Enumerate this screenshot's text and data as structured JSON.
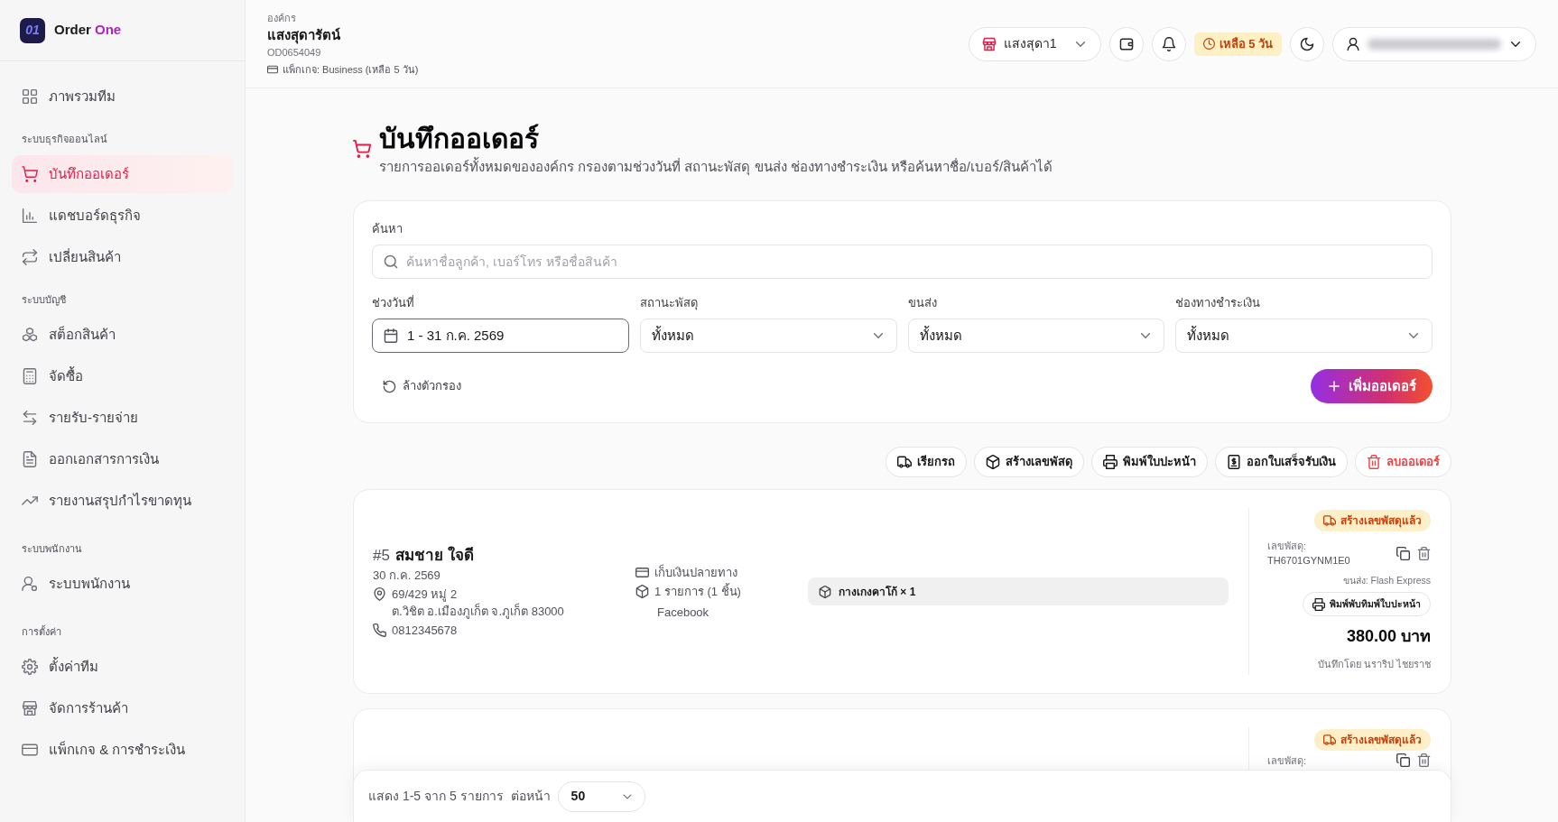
{
  "brand": {
    "logo": "01",
    "name": "Order",
    "name_accent": "One"
  },
  "sidebar": {
    "sections": [
      {
        "items": [
          {
            "label": "ภาพรวมทีม",
            "selected": false
          }
        ]
      },
      {
        "title": "ระบบธุรกิจออนไลน์",
        "items": [
          {
            "label": "บันทึกออเดอร์",
            "selected": true
          },
          {
            "label": "แดชบอร์ดธุรกิจ",
            "selected": false
          },
          {
            "label": "เปลี่ยนสินค้า",
            "selected": false
          }
        ]
      },
      {
        "title": "ระบบบัญชี",
        "items": [
          {
            "label": "สต็อกสินค้า",
            "selected": false
          },
          {
            "label": "จัดซื้อ",
            "selected": false
          },
          {
            "label": "รายรับ-รายจ่าย",
            "selected": false
          },
          {
            "label": "ออกเอกสารการเงิน",
            "selected": false
          },
          {
            "label": "รายงานสรุปกำไรขาดทุน",
            "selected": false
          }
        ]
      },
      {
        "title": "ระบบพนักงาน",
        "items": [
          {
            "label": "ระบบพนักงาน",
            "selected": false
          }
        ]
      },
      {
        "title": "การตั้งค่า",
        "items": [
          {
            "label": "ตั้งค่าทีม",
            "selected": false
          },
          {
            "label": "จัดการร้านค้า",
            "selected": false
          },
          {
            "label": "แพ็กเกจ & การชำระเงิน",
            "selected": false
          }
        ]
      }
    ]
  },
  "header": {
    "org_label": "องค์กร",
    "org_name": "แสงสุดารัตน์",
    "org_code": "OD0654049",
    "package": "แพ็กเกจ: Business (เหลือ 5 วัน)",
    "store": "แสงสุดา1",
    "trial": "เหลือ 5 วัน"
  },
  "page": {
    "title": "บันทึกออเดอร์",
    "subtitle": "รายการออเดอร์ทั้งหมดขององค์กร กรองตามช่วงวันที่ สถานะพัสดุ ขนส่ง ช่องทางชำระเงิน หรือค้นหาชื่อ/เบอร์/สินค้าได้"
  },
  "filters": {
    "search": {
      "label": "ค้นหา",
      "placeholder": "ค้นหาชื่อลูกค้า, เบอร์โทร หรือชื่อสินค้า"
    },
    "fields": [
      {
        "kind": "date",
        "label": "ช่วงวันที่",
        "value": "1 - 31 ก.ค. 2569",
        "focused": true
      },
      {
        "kind": "select",
        "label": "สถานะพัสดุ",
        "value": "ทั้งหมด",
        "focused": false
      },
      {
        "kind": "select",
        "label": "ขนส่ง",
        "value": "ทั้งหมด",
        "focused": false
      },
      {
        "kind": "select",
        "label": "ช่องทางชำระเงิน",
        "value": "ทั้งหมด",
        "focused": false
      }
    ],
    "clear_button": "ล้างตัวกรอง",
    "add_button": "เพิ่มออเดอร์"
  },
  "toolbar": [
    {
      "label": "เรียกรถ",
      "kind": "default"
    },
    {
      "label": "สร้างเลขพัสดุ",
      "kind": "default"
    },
    {
      "label": "พิมพ์ใบปะหน้า",
      "kind": "default"
    },
    {
      "label": "ออกใบเสร็จรับเงิน",
      "kind": "default"
    },
    {
      "label": "ลบออเดอร์",
      "kind": "danger"
    }
  ],
  "orders": [
    {
      "number": "#5",
      "customer": "สมชาย ใจดี",
      "date": "30 ก.ค. 2569",
      "address": [
        "69/429 หมู่ 2",
        "ต.วิชิต อ.เมืองภูเก็ต จ.ภูเก็ต 83000"
      ],
      "phone": "0812345678",
      "payment": "เก็บเงินปลายทาง",
      "item_count": "1 รายการ (1 ชิ้น)",
      "channel": "Facebook",
      "products": [
        "กางเกงคาโก้ × 1"
      ],
      "status": "สร้างเลขพัสดุแล้ว",
      "tracking_label": "เลขพัสดุ:",
      "tracking_number": "TH6701GYNM1E0",
      "carrier": "ขนส่ง: Flash Express",
      "print_button": "พิมพ์พับทิมพ์ใบปะหน้า",
      "total": "380.00 บาท",
      "recorded_by": "บันทึกโดย นราริป ไชยราช"
    },
    {
      "status": "สร้างเลขพัสดุแล้ว",
      "tracking_label": "เลขพัสดุ:"
    }
  ],
  "pagination": {
    "summary": "แสดง 1-5 จาก 5 รายการ",
    "per_page_label": "ต่อหน้า",
    "per_page": "50"
  }
}
